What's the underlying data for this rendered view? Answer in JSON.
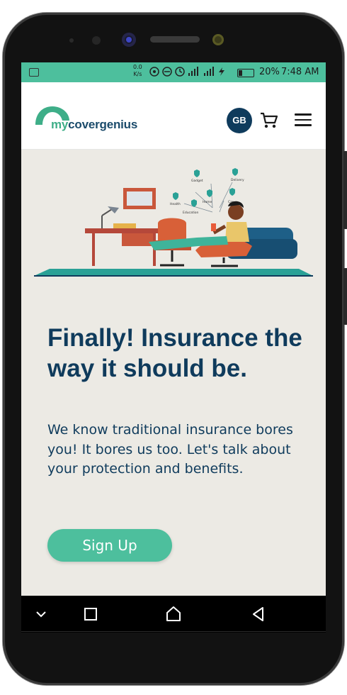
{
  "status_bar": {
    "speed_value": "0.0",
    "speed_unit": "K/s",
    "battery": "20%",
    "time": "7:48 AM"
  },
  "header": {
    "logo_prefix": "my",
    "logo_text": "covergenius",
    "avatar_initials": "GB",
    "icons": [
      "cart-icon",
      "menu-icon"
    ]
  },
  "hero": {
    "illustration_labels": [
      "Gadget",
      "Delivery",
      "Health",
      "Home",
      "Car",
      "Education"
    ],
    "headline": "Finally! Insurance the way it should be.",
    "subtext": "We know traditional insurance bores you! It bores us too. Let's talk about your protection and benefits.",
    "signup_label": "Sign Up"
  },
  "colors": {
    "accent": "#4dbf9d",
    "brand_dark": "#0f3b5c",
    "hero_bg": "#eceae4",
    "chat": "#1fa38a"
  },
  "nav": [
    "chevron-down-icon",
    "recents-icon",
    "home-icon",
    "back-icon"
  ]
}
